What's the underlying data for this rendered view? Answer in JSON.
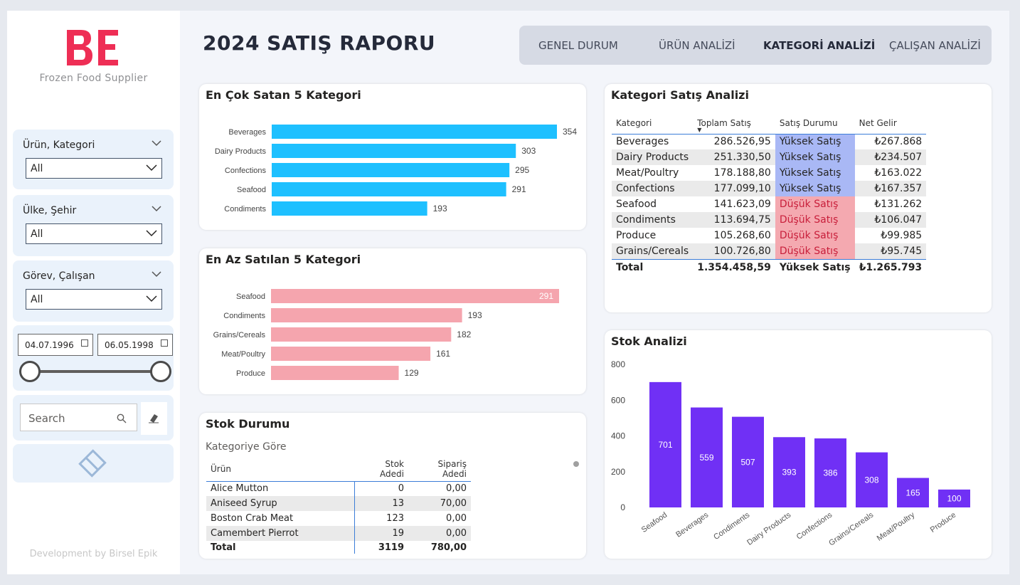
{
  "brand": {
    "tagline": "Frozen Food Supplier",
    "developer": "Development by Birsel Epik",
    "logo_color": "#ee2e55"
  },
  "page_title": "2024 SATIŞ RAPORU",
  "nav": {
    "tabs": [
      {
        "label": "GENEL DURUM"
      },
      {
        "label": "ÜRÜN ANALİZİ"
      },
      {
        "label": "KATEGORİ ANALİZİ",
        "active": true
      },
      {
        "label": "ÇALIŞAN ANALİZİ"
      }
    ]
  },
  "filters": {
    "product": {
      "title": "Ürün, Kategori",
      "value": "All"
    },
    "country": {
      "title": "Ülke, Şehir",
      "value": "All"
    },
    "employee": {
      "title": "Görev, Çalışan",
      "value": "All"
    },
    "date": {
      "start": "04.07.1996",
      "end": "06.05.1998"
    },
    "search": {
      "placeholder": "Search"
    }
  },
  "top5": {
    "title": "En Çok Satan 5 Kategori",
    "color": "#1ec0ff",
    "chart_data": {
      "type": "bar",
      "orientation": "horizontal",
      "categories": [
        "Beverages",
        "Dairy Products",
        "Confections",
        "Seafood",
        "Condiments"
      ],
      "values": [
        354,
        303,
        295,
        291,
        193
      ]
    }
  },
  "bottom5": {
    "title": "En Az Satılan 5 Kategori",
    "color": "#f5a5ae",
    "chart_data": {
      "type": "bar",
      "orientation": "horizontal",
      "categories": [
        "Seafood",
        "Condiments",
        "Grains/Cereals",
        "Meat/Poultry",
        "Produce"
      ],
      "values": [
        291,
        193,
        182,
        161,
        129
      ]
    }
  },
  "sales_analysis": {
    "title": "Kategori Satış Analizi",
    "headers": [
      "Kategori",
      "Toplam Satış",
      "Satış Durumu",
      "Net Gelir"
    ],
    "rows": [
      {
        "category": "Beverages",
        "total": "286.526,95",
        "status": "Yüksek Satış",
        "level": "hi",
        "net": "₺267.868"
      },
      {
        "category": "Dairy Products",
        "total": "251.330,50",
        "status": "Yüksek Satış",
        "level": "hi",
        "net": "₺234.507"
      },
      {
        "category": "Meat/Poultry",
        "total": "178.188,80",
        "status": "Yüksek Satış",
        "level": "hi",
        "net": "₺163.022"
      },
      {
        "category": "Confections",
        "total": "177.099,10",
        "status": "Yüksek Satış",
        "level": "hi",
        "net": "₺167.357"
      },
      {
        "category": "Seafood",
        "total": "141.623,09",
        "status": "Düşük Satış",
        "level": "lo",
        "net": "₺131.262"
      },
      {
        "category": "Condiments",
        "total": "113.694,75",
        "status": "Düşük Satış",
        "level": "lo",
        "net": "₺106.047"
      },
      {
        "category": "Produce",
        "total": "105.268,60",
        "status": "Düşük Satış",
        "level": "lo",
        "net": "₺99.985"
      },
      {
        "category": "Grains/Cereals",
        "total": "100.726,80",
        "status": "Düşük Satış",
        "level": "lo",
        "net": "₺95.745"
      }
    ],
    "totals": {
      "category": "Total",
      "total": "1.354.458,59",
      "status": "Yüksek Satış",
      "net": "₺1.265.793"
    }
  },
  "stock_status": {
    "title": "Stok Durumu",
    "subtitle": "Kategoriye Göre",
    "headers": [
      "Ürün",
      "Stok Adedi",
      "Sipariş Adedi"
    ],
    "rows": [
      {
        "product": "Alice Mutton",
        "stock": "0",
        "order": "0,00"
      },
      {
        "product": "Aniseed Syrup",
        "stock": "13",
        "order": "70,00"
      },
      {
        "product": "Boston Crab Meat",
        "stock": "123",
        "order": "0,00"
      },
      {
        "product": "Camembert Pierrot",
        "stock": "19",
        "order": "0,00"
      }
    ],
    "totals": {
      "product": "Total",
      "stock": "3119",
      "order": "780,00"
    }
  },
  "stock_analysis": {
    "title": "Stok Analizi",
    "color": "#7030f5",
    "chart_data": {
      "type": "bar",
      "categories": [
        "Seafood",
        "Beverages",
        "Condiments",
        "Dairy Products",
        "Confections",
        "Grains/Cereals",
        "Meat/Poultry",
        "Produce"
      ],
      "values": [
        701,
        559,
        507,
        393,
        386,
        308,
        165,
        100
      ],
      "ylim": [
        0,
        800
      ],
      "yticks": [
        0,
        200,
        400,
        600,
        800
      ]
    }
  }
}
